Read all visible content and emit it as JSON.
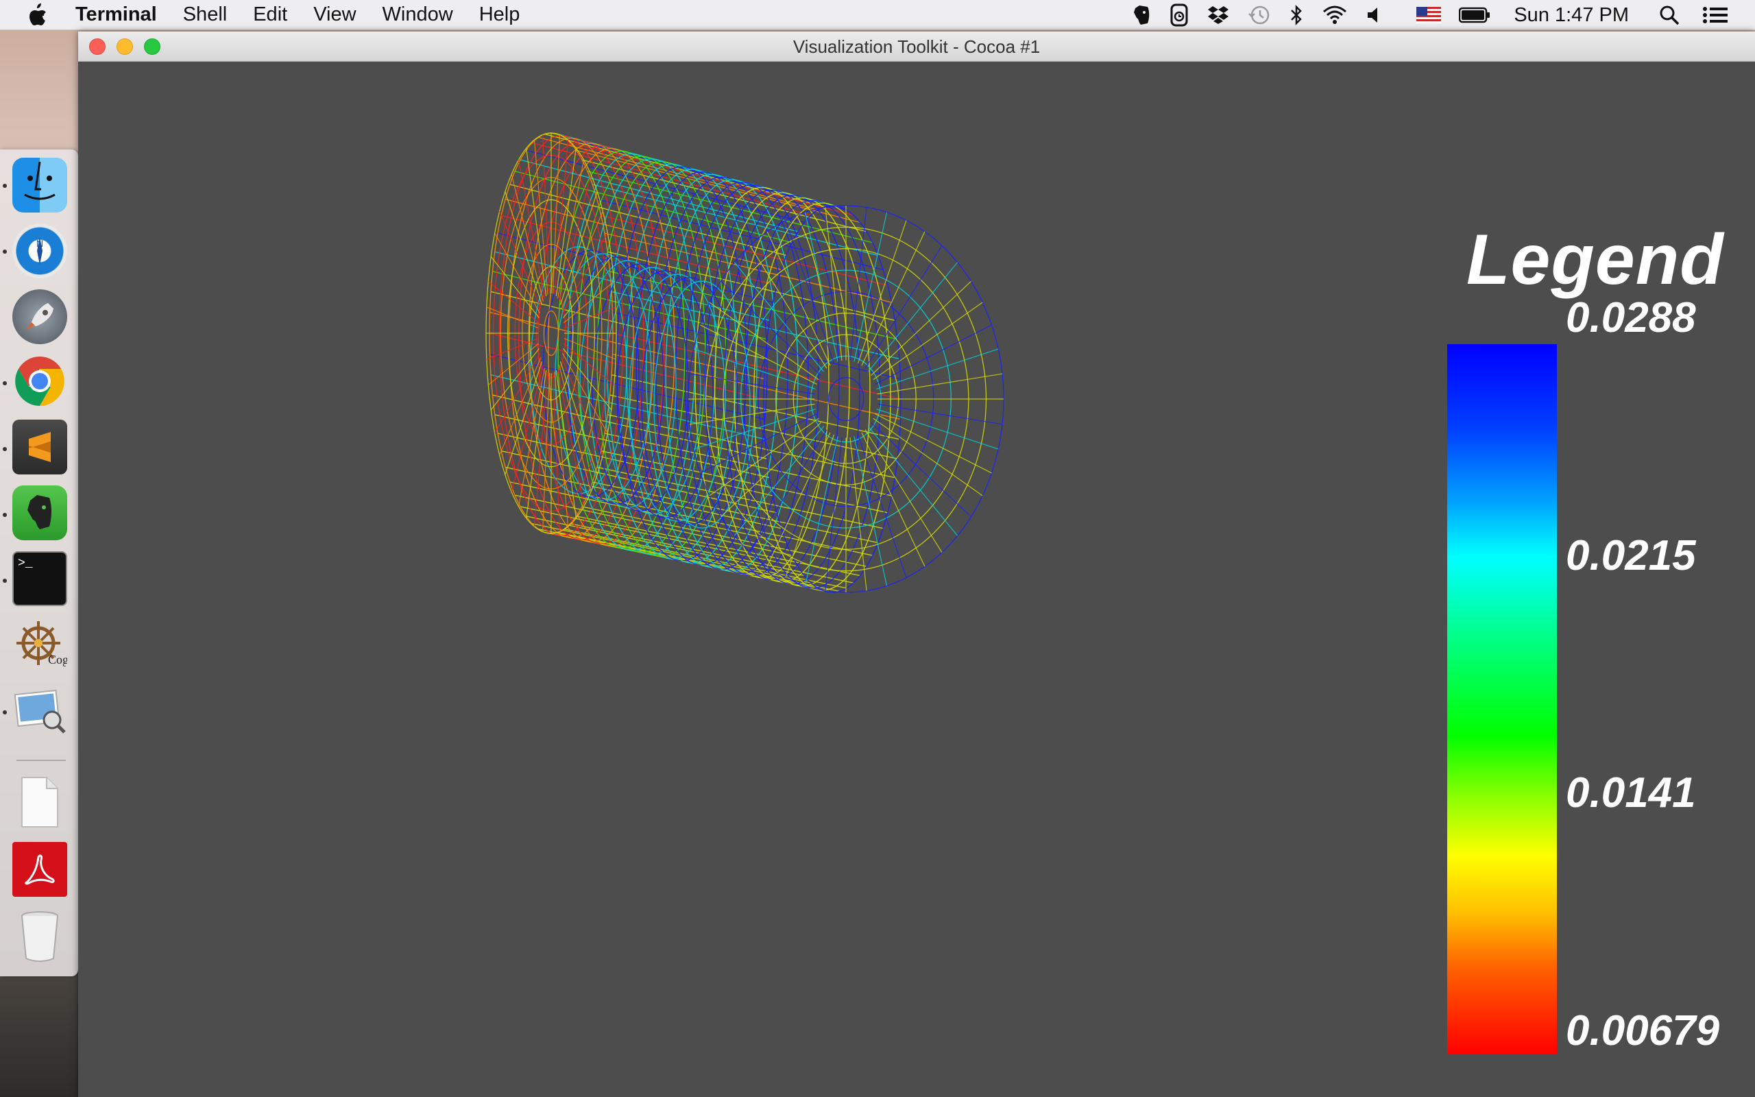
{
  "menubar": {
    "app_name": "Terminal",
    "menus": [
      "Shell",
      "Edit",
      "View",
      "Window",
      "Help"
    ],
    "clock": "Sun 1:47 PM",
    "status_icons": [
      "evernote-icon",
      "time-machine-alt-icon",
      "dropbox-icon",
      "time-machine-icon",
      "bluetooth-icon",
      "wifi-icon",
      "volume-icon",
      "us-flag-icon",
      "battery-icon",
      "spotlight-icon",
      "notification-center-icon"
    ]
  },
  "dock": {
    "items": [
      "finder-icon",
      "compass-icon",
      "launchpad-icon",
      "chrome-icon",
      "sublime-text-icon",
      "evernote-icon",
      "terminal-icon",
      "cog-icon",
      "preview-icon",
      "document-icon",
      "acrobat-icon",
      "trash-icon"
    ]
  },
  "window": {
    "title": "Visualization Toolkit - Cocoa #1"
  },
  "legend": {
    "title": "Legend",
    "labels": [
      "0.0288",
      "0.0215",
      "0.0141",
      "0.00679"
    ],
    "colors": [
      "#0000ff",
      "#00ffff",
      "#00ff00",
      "#ffff00",
      "#ff0000"
    ]
  },
  "viz": {
    "type": "wireframe-cylinder",
    "background": "#4d4d4d"
  }
}
